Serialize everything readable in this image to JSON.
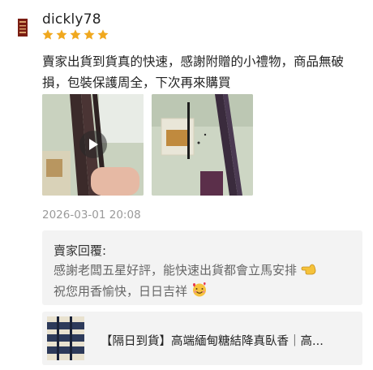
{
  "review": {
    "username": "dickly78",
    "rating": 5,
    "text": "賣家出貨到貨真的快速，感謝附贈的小禮物，商品無破損，包裝保護周全，下次再來購買",
    "timestamp": "2026-03-01 20:08",
    "photos": [
      {
        "type": "video",
        "icon": "play-icon"
      },
      {
        "type": "image"
      }
    ]
  },
  "seller_reply": {
    "title": "賣家回覆:",
    "line1": "感謝老闆五星好評，能快速出貨都會立馬安排",
    "line2": "祝您用香愉快，日日吉祥"
  },
  "product": {
    "title": "【隔日到貨】高端緬甸糖結降真臥香｜高..."
  },
  "colors": {
    "star": "#f0a81e",
    "timestamp": "#9a9a9a",
    "reply_bg": "#f3f3f3",
    "reply_text": "#666666"
  }
}
